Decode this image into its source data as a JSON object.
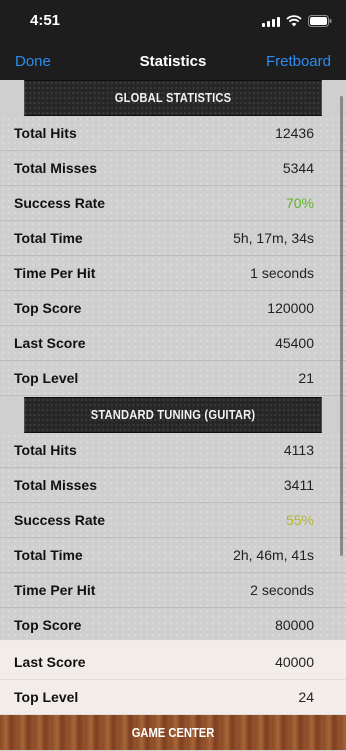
{
  "status_bar": {
    "time": "4:51"
  },
  "nav": {
    "done_label": "Done",
    "title": "Statistics",
    "fretboard_label": "Fretboard"
  },
  "sections": [
    {
      "title": "GLOBAL STATISTICS",
      "rows": [
        {
          "label": "Total Hits",
          "value": "12436"
        },
        {
          "label": "Total Misses",
          "value": "5344"
        },
        {
          "label": "Success Rate",
          "value": "70%"
        },
        {
          "label": "Total Time",
          "value": "5h, 17m, 34s"
        },
        {
          "label": "Time Per Hit",
          "value": "1 seconds"
        },
        {
          "label": "Top Score",
          "value": "120000"
        },
        {
          "label": "Last Score",
          "value": "45400"
        },
        {
          "label": "Top Level",
          "value": "21"
        }
      ]
    },
    {
      "title": "STANDARD TUNING (GUITAR)",
      "rows": [
        {
          "label": "Total Hits",
          "value": "4113"
        },
        {
          "label": "Total Misses",
          "value": "3411"
        },
        {
          "label": "Success Rate",
          "value": "55%"
        },
        {
          "label": "Total Time",
          "value": "2h, 46m, 41s"
        },
        {
          "label": "Time Per Hit",
          "value": "2 seconds"
        },
        {
          "label": "Top Score",
          "value": "80000"
        },
        {
          "label": "Last Score",
          "value": "40000"
        },
        {
          "label": "Top Level",
          "value": "24"
        }
      ]
    },
    {
      "title": "GAME CENTER"
    }
  ],
  "colors": {
    "accent": "#2d8cf0",
    "rate_global": "#5fb52c",
    "rate_standard": "#b5b62c"
  }
}
